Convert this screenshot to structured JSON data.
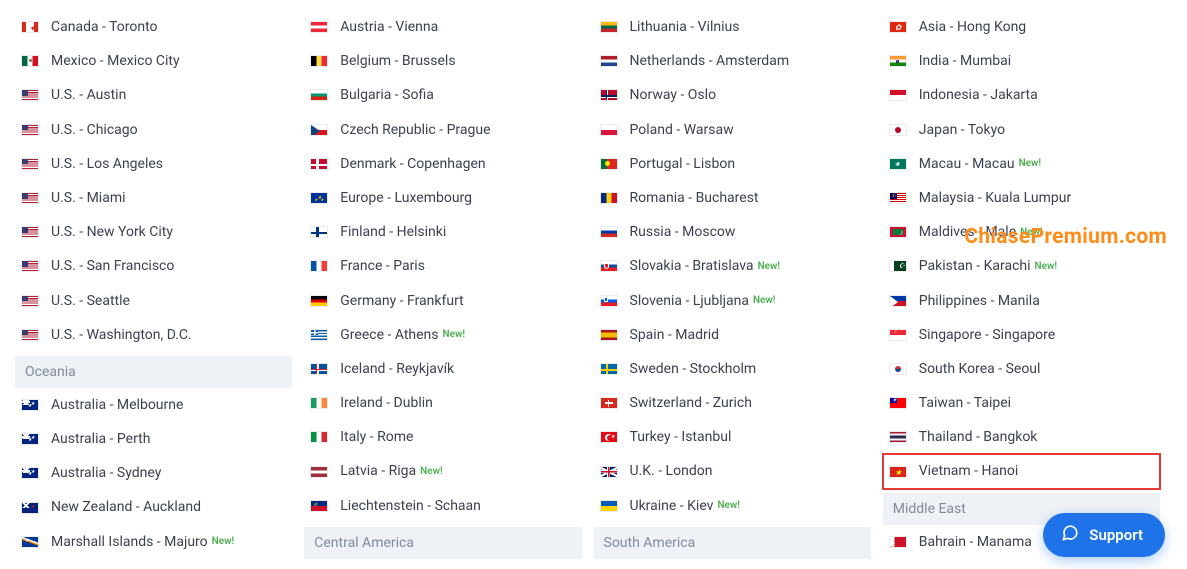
{
  "watermark": "ChiasePremium.com",
  "support_label": "Support",
  "new_badge": "New!",
  "regions": {
    "oceania": "Oceania",
    "central_america": "Central America",
    "south_america": "South America",
    "middle_east": "Middle East"
  },
  "columns": [
    [
      {
        "flag": "ca",
        "label": "Canada - Toronto"
      },
      {
        "flag": "mx",
        "label": "Mexico - Mexico City"
      },
      {
        "flag": "us",
        "label": "U.S. - Austin"
      },
      {
        "flag": "us",
        "label": "U.S. - Chicago"
      },
      {
        "flag": "us",
        "label": "U.S. - Los Angeles"
      },
      {
        "flag": "us",
        "label": "U.S. - Miami"
      },
      {
        "flag": "us",
        "label": "U.S. - New York City"
      },
      {
        "flag": "us",
        "label": "U.S. - San Francisco"
      },
      {
        "flag": "us",
        "label": "U.S. - Seattle"
      },
      {
        "flag": "us",
        "label": "U.S. - Washington, D.C."
      },
      {
        "region": "oceania"
      },
      {
        "flag": "au",
        "label": "Australia - Melbourne"
      },
      {
        "flag": "au",
        "label": "Australia - Perth"
      },
      {
        "flag": "au",
        "label": "Australia - Sydney"
      },
      {
        "flag": "nz",
        "label": "New Zealand - Auckland"
      },
      {
        "flag": "mh",
        "label": "Marshall Islands - Majuro",
        "new": true
      }
    ],
    [
      {
        "flag": "at",
        "label": "Austria - Vienna"
      },
      {
        "flag": "be",
        "label": "Belgium - Brussels"
      },
      {
        "flag": "bg",
        "label": "Bulgaria - Sofia"
      },
      {
        "flag": "cz",
        "label": "Czech Republic - Prague"
      },
      {
        "flag": "dk",
        "label": "Denmark - Copenhagen"
      },
      {
        "flag": "eu",
        "label": "Europe - Luxembourg"
      },
      {
        "flag": "fi",
        "label": "Finland - Helsinki"
      },
      {
        "flag": "fr",
        "label": "France - Paris"
      },
      {
        "flag": "de",
        "label": "Germany - Frankfurt"
      },
      {
        "flag": "gr",
        "label": "Greece - Athens",
        "new": true
      },
      {
        "flag": "is",
        "label": "Iceland - Reykjavík"
      },
      {
        "flag": "ie",
        "label": "Ireland - Dublin"
      },
      {
        "flag": "it",
        "label": "Italy - Rome"
      },
      {
        "flag": "lv",
        "label": "Latvia - Riga",
        "new": true
      },
      {
        "flag": "li",
        "label": "Liechtenstein - Schaan"
      },
      {
        "region": "central_america"
      }
    ],
    [
      {
        "flag": "lt",
        "label": "Lithuania - Vilnius"
      },
      {
        "flag": "nl",
        "label": "Netherlands - Amsterdam"
      },
      {
        "flag": "no",
        "label": "Norway - Oslo"
      },
      {
        "flag": "pl",
        "label": "Poland - Warsaw"
      },
      {
        "flag": "pt",
        "label": "Portugal - Lisbon"
      },
      {
        "flag": "ro",
        "label": "Romania - Bucharest"
      },
      {
        "flag": "ru",
        "label": "Russia - Moscow"
      },
      {
        "flag": "sk",
        "label": "Slovakia - Bratislava",
        "new": true
      },
      {
        "flag": "si",
        "label": "Slovenia - Ljubljana",
        "new": true
      },
      {
        "flag": "es",
        "label": "Spain - Madrid"
      },
      {
        "flag": "se",
        "label": "Sweden - Stockholm"
      },
      {
        "flag": "ch",
        "label": "Switzerland - Zurich"
      },
      {
        "flag": "tr",
        "label": "Turkey - Istanbul"
      },
      {
        "flag": "gb",
        "label": "U.K. - London"
      },
      {
        "flag": "ua",
        "label": "Ukraine - Kiev",
        "new": true
      },
      {
        "region": "south_america"
      }
    ],
    [
      {
        "flag": "hk",
        "label": "Asia - Hong Kong"
      },
      {
        "flag": "in",
        "label": "India - Mumbai"
      },
      {
        "flag": "id",
        "label": "Indonesia - Jakarta"
      },
      {
        "flag": "jp",
        "label": "Japan - Tokyo"
      },
      {
        "flag": "mo",
        "label": "Macau - Macau",
        "new": true
      },
      {
        "flag": "my",
        "label": "Malaysia - Kuala Lumpur"
      },
      {
        "flag": "mv",
        "label": "Maldives - Male",
        "new": true
      },
      {
        "flag": "pk",
        "label": "Pakistan - Karachi",
        "new": true
      },
      {
        "flag": "ph",
        "label": "Philippines - Manila"
      },
      {
        "flag": "sg",
        "label": "Singapore - Singapore"
      },
      {
        "flag": "kr",
        "label": "South Korea - Seoul"
      },
      {
        "flag": "tw",
        "label": "Taiwan - Taipei"
      },
      {
        "flag": "th",
        "label": "Thailand - Bangkok"
      },
      {
        "flag": "vn",
        "label": "Vietnam - Hanoi",
        "highlight": true
      },
      {
        "region": "middle_east"
      },
      {
        "flag": "bh",
        "label": "Bahrain - Manama"
      }
    ]
  ]
}
